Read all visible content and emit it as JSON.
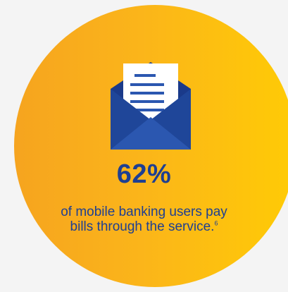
{
  "stat": {
    "value": "62%",
    "line1": "of mobile banking users pay",
    "line2": "bills through the service.",
    "footnote": "6"
  },
  "icons": {
    "envelope": "envelope-open-letter-icon"
  },
  "colors": {
    "background": "#f4f4f4",
    "circle_start": "#f6a41f",
    "circle_end": "#ffcb05",
    "text": "#1e3f92",
    "envelope_dark": "#1a3a8a",
    "envelope_light": "#2b57b0"
  }
}
